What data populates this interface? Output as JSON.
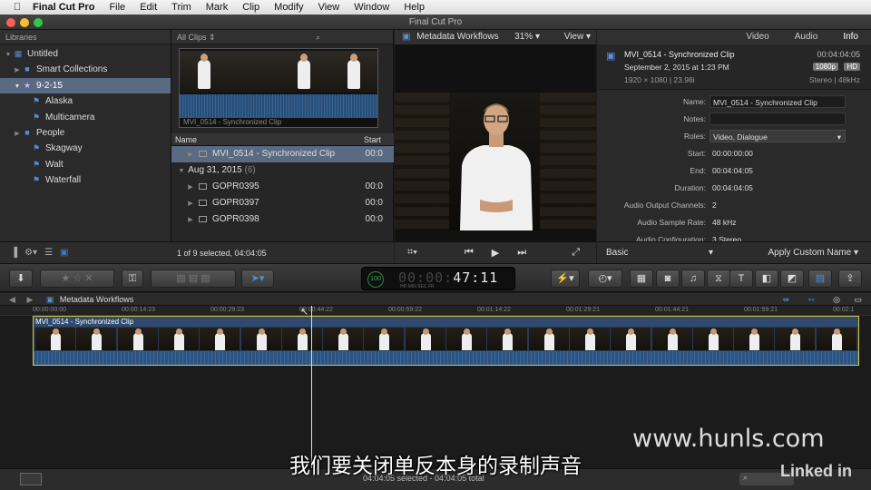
{
  "menubar": {
    "app": "Final Cut Pro",
    "items": [
      "File",
      "Edit",
      "Trim",
      "Mark",
      "Clip",
      "Modify",
      "View",
      "Window",
      "Help"
    ]
  },
  "window": {
    "title": "Final Cut Pro"
  },
  "libraries": {
    "header": "Libraries",
    "items": [
      {
        "label": "Untitled",
        "icon": "library-icon",
        "level": 0
      },
      {
        "label": "Smart Collections",
        "icon": "folder-icon",
        "level": 1
      },
      {
        "label": "9-2-15",
        "icon": "event-icon",
        "level": 1,
        "selected": true
      },
      {
        "label": "Alaska",
        "icon": "keyword-icon",
        "level": 2
      },
      {
        "label": "Multicamera",
        "icon": "keyword-icon",
        "level": 2
      },
      {
        "label": "People",
        "icon": "folder-icon",
        "level": 2
      },
      {
        "label": "Skagway",
        "icon": "keyword-icon",
        "level": 2
      },
      {
        "label": "Walt",
        "icon": "keyword-icon",
        "level": 2
      },
      {
        "label": "Waterfall",
        "icon": "keyword-icon",
        "level": 2
      }
    ]
  },
  "browser": {
    "filter": "All Clips",
    "filmstrip_caption": "MVI_0514 - Synchronized Clip",
    "columns": {
      "name": "Name",
      "start": "Start"
    },
    "rows": [
      {
        "name": "MVI_0514 - Synchronized Clip",
        "start": "00:0",
        "selected": true
      },
      {
        "group": "Aug 31, 2015",
        "count": "(6)"
      },
      {
        "name": "GOPR0395",
        "start": "00:0"
      },
      {
        "name": "GOPR0397",
        "start": "00:0"
      },
      {
        "name": "GOPR0398",
        "start": "00:0"
      }
    ],
    "status": "1 of 9 selected, 04:04:05"
  },
  "viewer": {
    "title": "Metadata Workflows",
    "zoom": "31%",
    "view_menu": "View"
  },
  "inspector": {
    "tabs": [
      "Video",
      "Audio",
      "Info"
    ],
    "active_tab": "Info",
    "clip_name": "MVI_0514 - Synchronized Clip",
    "duration": "00:04:04:05",
    "date": "September 2, 2015 at 1:23 PM",
    "badge_res": "1080p",
    "badge_hd": "HD",
    "format": "1920 × 1080  |  23.98i",
    "audio_format": "Stereo  |  48kHz",
    "fields": [
      {
        "label": "Name:",
        "value": "MVI_0514 - Synchronized Clip",
        "kind": "box"
      },
      {
        "label": "Notes:",
        "value": "",
        "kind": "box"
      },
      {
        "label": "Roles:",
        "value": "Video, Dialogue",
        "kind": "drop"
      },
      {
        "label": "Start:",
        "value": "00:00:00:00",
        "kind": "text"
      },
      {
        "label": "End:",
        "value": "00:04:04:05",
        "kind": "text"
      },
      {
        "label": "Duration:",
        "value": "00:04:04:05",
        "kind": "text"
      },
      {
        "label": "Audio Output Channels:",
        "value": "2",
        "kind": "text"
      },
      {
        "label": "Audio Sample Rate:",
        "value": "48 kHz",
        "kind": "text"
      },
      {
        "label": "Audio Configuration:",
        "value": "3 Stereo",
        "kind": "text"
      }
    ],
    "view_set": "Basic",
    "apply_button": "Apply Custom Name"
  },
  "toolbar": {
    "timecode": "47:11",
    "timecode_prefix": "00:00:",
    "tc_labels": "HR    MIN   SEC   FR",
    "percent_badge": "100"
  },
  "timeline": {
    "project": "Metadata Workflows",
    "ruler": [
      "00:00:00:00",
      "00:00:14:23",
      "00:00:29:23",
      "00:00:44:22",
      "00:00:59:22",
      "00:01:14:22",
      "00:01:29:21",
      "00:01:44:21",
      "00:01:59:21",
      "00:02:1"
    ],
    "clip_title": "MVI_0514 - Synchronized Clip",
    "status": "04:04:05 selected - 04:04:05 total"
  },
  "overlay": {
    "subtitle": "我们要关闭单反本身的录制声音",
    "watermark": "www.hunls.com",
    "brand": "Linked in"
  },
  "colors": {
    "selection": "#5a6a82",
    "accent_blue": "#3b78c8",
    "clip_border": "#d8c840"
  }
}
